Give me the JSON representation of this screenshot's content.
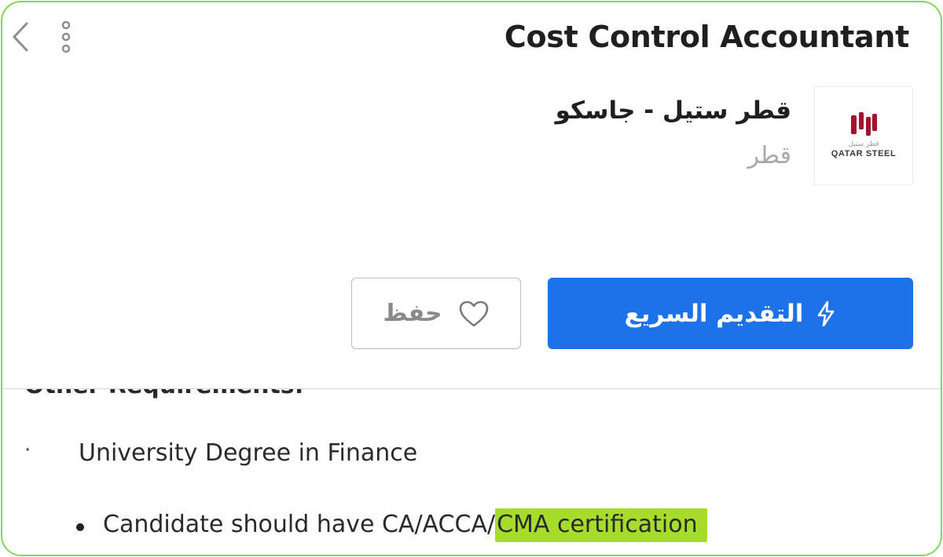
{
  "header": {
    "back_icon": "chevron-left-icon",
    "menu_icon": "more-vertical-icon",
    "job_title": "Cost Control Accountant"
  },
  "company": {
    "name": "قطر ستيل - جاسكو",
    "location": "قطر",
    "logo_arabic": "قطر ستيل",
    "logo_text": "QATAR STEEL"
  },
  "actions": {
    "apply_label": "التقديم السريع",
    "apply_icon": "lightning-bolt-icon",
    "save_label": "حفظ",
    "save_icon": "heart-icon"
  },
  "requirements": {
    "heading": "Other Requirements:",
    "item_1": "University Degree in Finance",
    "item_2_prefix": "Candidate should have CA/ACCA/",
    "item_2_highlight": "CMA certification"
  },
  "colors": {
    "primary": "#1d72e8",
    "highlight": "#a6dc2a",
    "frame_border": "#7ed957",
    "logo_red": "#a3142c"
  }
}
